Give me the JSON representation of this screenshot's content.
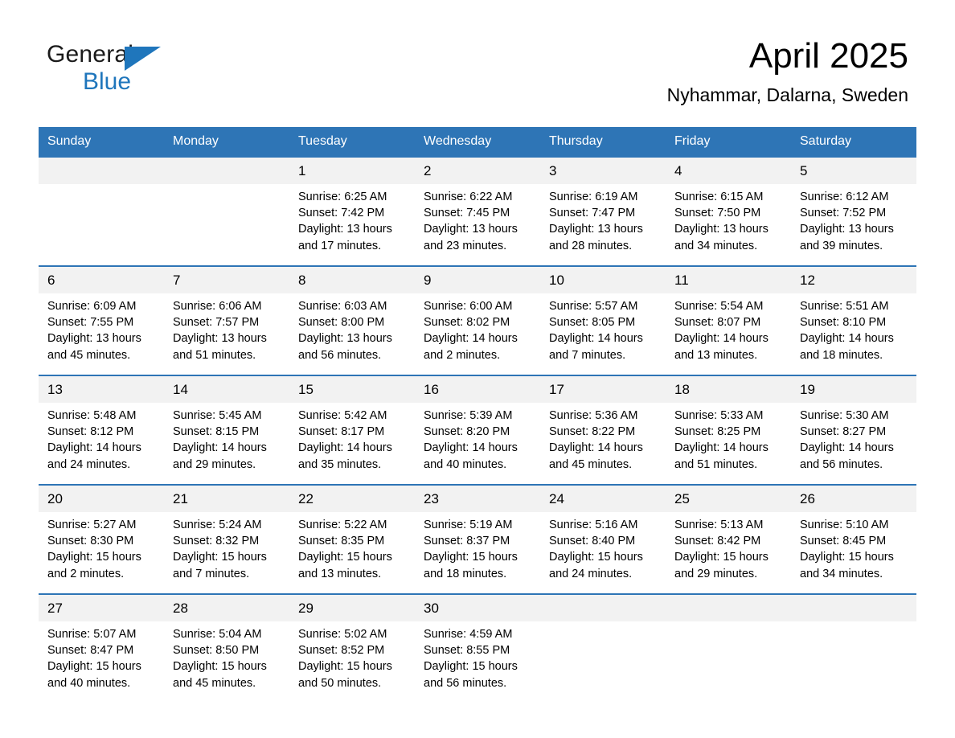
{
  "brand": {
    "logo_line1": "General",
    "logo_line2": "Blue",
    "logo_triangle_icon": "triangle-icon",
    "black": "#1a1a1a",
    "blue": "#1f76bc"
  },
  "header": {
    "month_title": "April 2025",
    "location": "Nyhammar, Dalarna, Sweden"
  },
  "colors": {
    "header_blue": "#2e75b6",
    "daynum_band": "#f2f2f2",
    "text": "#000000"
  },
  "weekdays": [
    "Sunday",
    "Monday",
    "Tuesday",
    "Wednesday",
    "Thursday",
    "Friday",
    "Saturday"
  ],
  "weeks": [
    {
      "daynums": [
        "",
        "",
        "1",
        "2",
        "3",
        "4",
        "5"
      ],
      "cells": [
        {
          "sunrise": "",
          "sunset": "",
          "daylight": ""
        },
        {
          "sunrise": "",
          "sunset": "",
          "daylight": ""
        },
        {
          "sunrise": "Sunrise: 6:25 AM",
          "sunset": "Sunset: 7:42 PM",
          "daylight": "Daylight: 13 hours and 17 minutes."
        },
        {
          "sunrise": "Sunrise: 6:22 AM",
          "sunset": "Sunset: 7:45 PM",
          "daylight": "Daylight: 13 hours and 23 minutes."
        },
        {
          "sunrise": "Sunrise: 6:19 AM",
          "sunset": "Sunset: 7:47 PM",
          "daylight": "Daylight: 13 hours and 28 minutes."
        },
        {
          "sunrise": "Sunrise: 6:15 AM",
          "sunset": "Sunset: 7:50 PM",
          "daylight": "Daylight: 13 hours and 34 minutes."
        },
        {
          "sunrise": "Sunrise: 6:12 AM",
          "sunset": "Sunset: 7:52 PM",
          "daylight": "Daylight: 13 hours and 39 minutes."
        }
      ]
    },
    {
      "daynums": [
        "6",
        "7",
        "8",
        "9",
        "10",
        "11",
        "12"
      ],
      "cells": [
        {
          "sunrise": "Sunrise: 6:09 AM",
          "sunset": "Sunset: 7:55 PM",
          "daylight": "Daylight: 13 hours and 45 minutes."
        },
        {
          "sunrise": "Sunrise: 6:06 AM",
          "sunset": "Sunset: 7:57 PM",
          "daylight": "Daylight: 13 hours and 51 minutes."
        },
        {
          "sunrise": "Sunrise: 6:03 AM",
          "sunset": "Sunset: 8:00 PM",
          "daylight": "Daylight: 13 hours and 56 minutes."
        },
        {
          "sunrise": "Sunrise: 6:00 AM",
          "sunset": "Sunset: 8:02 PM",
          "daylight": "Daylight: 14 hours and 2 minutes."
        },
        {
          "sunrise": "Sunrise: 5:57 AM",
          "sunset": "Sunset: 8:05 PM",
          "daylight": "Daylight: 14 hours and 7 minutes."
        },
        {
          "sunrise": "Sunrise: 5:54 AM",
          "sunset": "Sunset: 8:07 PM",
          "daylight": "Daylight: 14 hours and 13 minutes."
        },
        {
          "sunrise": "Sunrise: 5:51 AM",
          "sunset": "Sunset: 8:10 PM",
          "daylight": "Daylight: 14 hours and 18 minutes."
        }
      ]
    },
    {
      "daynums": [
        "13",
        "14",
        "15",
        "16",
        "17",
        "18",
        "19"
      ],
      "cells": [
        {
          "sunrise": "Sunrise: 5:48 AM",
          "sunset": "Sunset: 8:12 PM",
          "daylight": "Daylight: 14 hours and 24 minutes."
        },
        {
          "sunrise": "Sunrise: 5:45 AM",
          "sunset": "Sunset: 8:15 PM",
          "daylight": "Daylight: 14 hours and 29 minutes."
        },
        {
          "sunrise": "Sunrise: 5:42 AM",
          "sunset": "Sunset: 8:17 PM",
          "daylight": "Daylight: 14 hours and 35 minutes."
        },
        {
          "sunrise": "Sunrise: 5:39 AM",
          "sunset": "Sunset: 8:20 PM",
          "daylight": "Daylight: 14 hours and 40 minutes."
        },
        {
          "sunrise": "Sunrise: 5:36 AM",
          "sunset": "Sunset: 8:22 PM",
          "daylight": "Daylight: 14 hours and 45 minutes."
        },
        {
          "sunrise": "Sunrise: 5:33 AM",
          "sunset": "Sunset: 8:25 PM",
          "daylight": "Daylight: 14 hours and 51 minutes."
        },
        {
          "sunrise": "Sunrise: 5:30 AM",
          "sunset": "Sunset: 8:27 PM",
          "daylight": "Daylight: 14 hours and 56 minutes."
        }
      ]
    },
    {
      "daynums": [
        "20",
        "21",
        "22",
        "23",
        "24",
        "25",
        "26"
      ],
      "cells": [
        {
          "sunrise": "Sunrise: 5:27 AM",
          "sunset": "Sunset: 8:30 PM",
          "daylight": "Daylight: 15 hours and 2 minutes."
        },
        {
          "sunrise": "Sunrise: 5:24 AM",
          "sunset": "Sunset: 8:32 PM",
          "daylight": "Daylight: 15 hours and 7 minutes."
        },
        {
          "sunrise": "Sunrise: 5:22 AM",
          "sunset": "Sunset: 8:35 PM",
          "daylight": "Daylight: 15 hours and 13 minutes."
        },
        {
          "sunrise": "Sunrise: 5:19 AM",
          "sunset": "Sunset: 8:37 PM",
          "daylight": "Daylight: 15 hours and 18 minutes."
        },
        {
          "sunrise": "Sunrise: 5:16 AM",
          "sunset": "Sunset: 8:40 PM",
          "daylight": "Daylight: 15 hours and 24 minutes."
        },
        {
          "sunrise": "Sunrise: 5:13 AM",
          "sunset": "Sunset: 8:42 PM",
          "daylight": "Daylight: 15 hours and 29 minutes."
        },
        {
          "sunrise": "Sunrise: 5:10 AM",
          "sunset": "Sunset: 8:45 PM",
          "daylight": "Daylight: 15 hours and 34 minutes."
        }
      ]
    },
    {
      "daynums": [
        "27",
        "28",
        "29",
        "30",
        "",
        "",
        ""
      ],
      "cells": [
        {
          "sunrise": "Sunrise: 5:07 AM",
          "sunset": "Sunset: 8:47 PM",
          "daylight": "Daylight: 15 hours and 40 minutes."
        },
        {
          "sunrise": "Sunrise: 5:04 AM",
          "sunset": "Sunset: 8:50 PM",
          "daylight": "Daylight: 15 hours and 45 minutes."
        },
        {
          "sunrise": "Sunrise: 5:02 AM",
          "sunset": "Sunset: 8:52 PM",
          "daylight": "Daylight: 15 hours and 50 minutes."
        },
        {
          "sunrise": "Sunrise: 4:59 AM",
          "sunset": "Sunset: 8:55 PM",
          "daylight": "Daylight: 15 hours and 56 minutes."
        },
        {
          "sunrise": "",
          "sunset": "",
          "daylight": ""
        },
        {
          "sunrise": "",
          "sunset": "",
          "daylight": ""
        },
        {
          "sunrise": "",
          "sunset": "",
          "daylight": ""
        }
      ]
    }
  ]
}
